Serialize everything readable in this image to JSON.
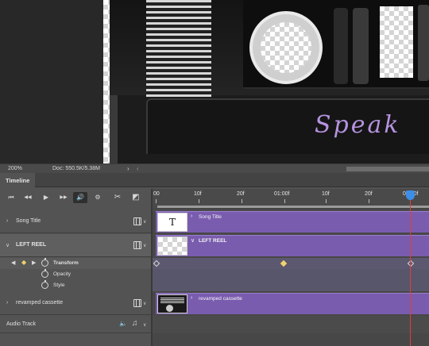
{
  "status_bar": {
    "zoom": "200%",
    "doc_size": "Doc: 550.5K/5.38M",
    "arrow_right": "›",
    "arrow_left": "‹"
  },
  "canvas": {
    "label_text": "Speak"
  },
  "timeline": {
    "tab_label": "Timeline",
    "controls": {
      "first_frame": "⏮",
      "prev_frame": "◀◀",
      "play": "▶",
      "next_frame": "▶▶",
      "mute": "🔊",
      "settings": "⚙",
      "split": "✂",
      "transition": "◩"
    },
    "ruler": {
      "ticks": [
        "00",
        "10f",
        "20f",
        "01:00f",
        "10f",
        "20f",
        "02:00f"
      ]
    },
    "layers": [
      {
        "name": "Song Title",
        "expanded": false
      },
      {
        "name": "LEFT REEL",
        "expanded": true
      },
      {
        "name": "revamped cassette",
        "expanded": false
      }
    ],
    "properties": [
      "Transform",
      "Opacity",
      "Style"
    ],
    "audio_track": "Audio Track",
    "clips": {
      "song_title": "Song Title",
      "left_reel": "LEFT REEL",
      "revamped_cassette": "revamped cassette",
      "text_thumb": "T"
    },
    "colors": {
      "clip": "#7a5caf",
      "playhead": "#e23c3c",
      "playhead_head": "#3c8ee6",
      "keyframe_active": "#f0d36a"
    }
  }
}
